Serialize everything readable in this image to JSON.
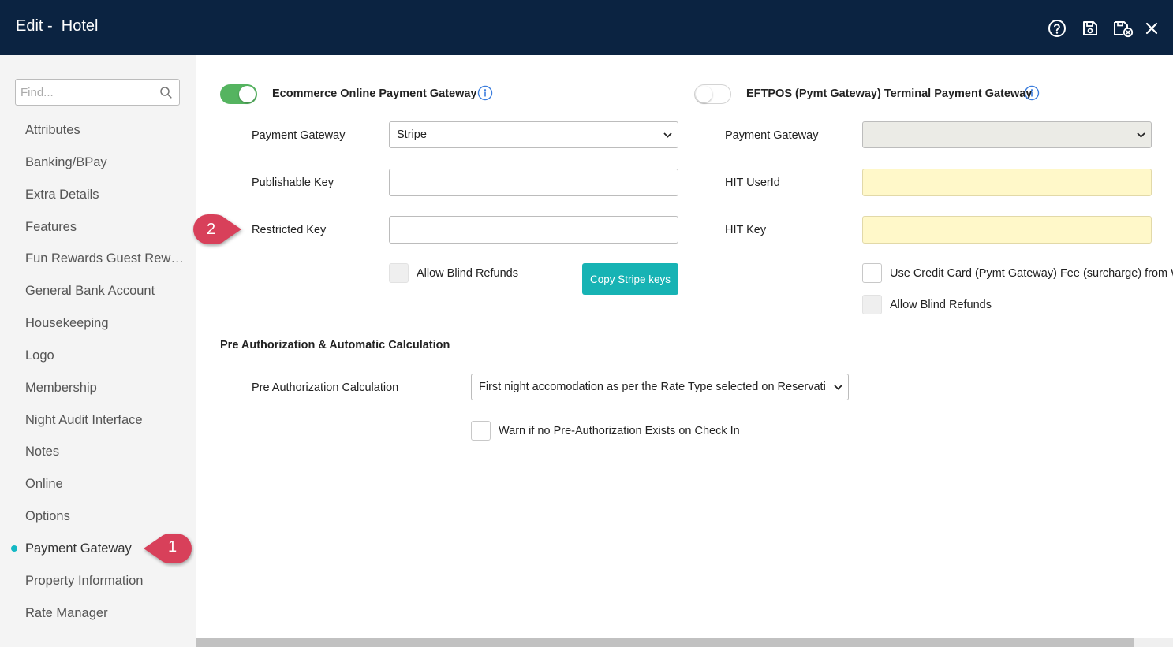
{
  "header": {
    "title": "Edit -  Hotel",
    "icons": [
      "help-icon",
      "save-icon",
      "save-close-icon",
      "close-icon"
    ]
  },
  "sidebar": {
    "search_placeholder": "Find...",
    "items": [
      {
        "label": "Attributes"
      },
      {
        "label": "Banking/BPay"
      },
      {
        "label": "Extra Details"
      },
      {
        "label": "Features"
      },
      {
        "label": "Fun Rewards Guest Rewards"
      },
      {
        "label": "General Bank Account"
      },
      {
        "label": "Housekeeping"
      },
      {
        "label": "Logo"
      },
      {
        "label": "Membership"
      },
      {
        "label": "Night Audit Interface"
      },
      {
        "label": "Notes"
      },
      {
        "label": "Online"
      },
      {
        "label": "Options"
      },
      {
        "label": "Payment Gateway",
        "active": true
      },
      {
        "label": "Property Information"
      },
      {
        "label": "Rate Manager"
      }
    ]
  },
  "ecommerce": {
    "title": "Ecommerce Online Payment Gateway",
    "enabled": true,
    "payment_gateway_label": "Payment Gateway",
    "payment_gateway_value": "Stripe",
    "publishable_key_label": "Publishable Key",
    "publishable_key_value": "",
    "restricted_key_label": "Restricted Key",
    "restricted_key_value": "",
    "allow_blind_refunds_label": "Allow Blind Refunds",
    "copy_button_label": "Copy Stripe keys"
  },
  "eftpos": {
    "title": "EFTPOS (Pymt Gateway) Terminal Payment Gateway",
    "enabled": false,
    "payment_gateway_label": "Payment Gateway",
    "payment_gateway_value": "",
    "hit_userid_label": "HIT UserId",
    "hit_key_label": "HIT Key",
    "surcharge_label": "Use Credit Card (Pymt Gateway) Fee (surcharge) from W",
    "allow_blind_refunds_label": "Allow Blind Refunds"
  },
  "preauth": {
    "section_title": "Pre Authorization & Automatic Calculation",
    "calc_label": "Pre Authorization Calculation",
    "calc_value": "First night accomodation as per the Rate Type selected on Reservati",
    "warn_label": "Warn if no Pre-Authorization Exists on Check In"
  },
  "callouts": [
    "1",
    "2"
  ],
  "colors": {
    "header_bg": "#0b2341",
    "accent": "#14b8c4",
    "toggle_on": "#55b460",
    "button": "#17b3b4",
    "callout": "#d8405a",
    "required_field": "#fff8c9"
  }
}
